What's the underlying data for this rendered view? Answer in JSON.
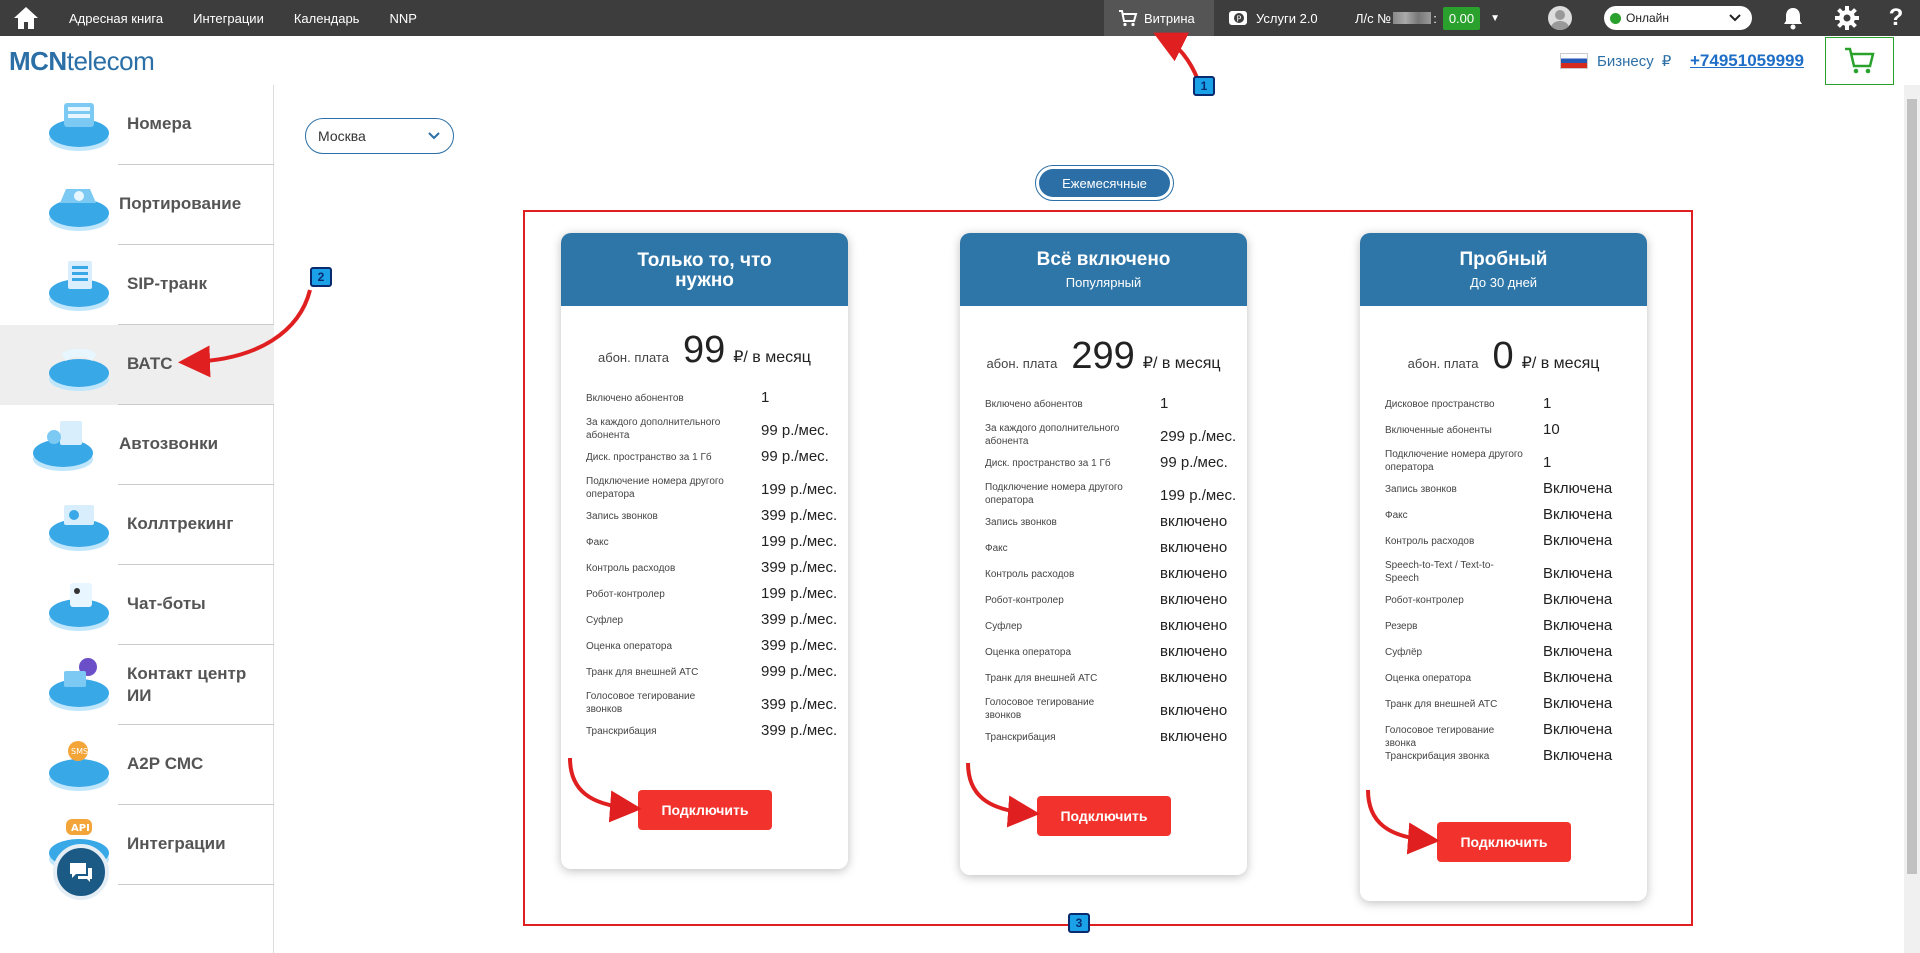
{
  "topbar": {
    "nav": [
      "Адресная книга",
      "Интеграции",
      "Календарь",
      "NNP"
    ],
    "vitrina": "Витрина",
    "uslugi": "Услуги 2.0",
    "account_prefix": "Л/с №",
    "account_suffix": ":",
    "balance": "0.00",
    "status": "Онлайн"
  },
  "header": {
    "logo_bold": "MCN",
    "logo_rest": "telecom",
    "business": "Бизнесу",
    "currency": "₽",
    "phone": "+74951059999"
  },
  "sidebar": {
    "items": [
      {
        "label": "Номера"
      },
      {
        "label": "Портирование"
      },
      {
        "label": "SIP-транк"
      },
      {
        "label": "ВАТС"
      },
      {
        "label": "Автозвонки"
      },
      {
        "label": "Коллтрекинг"
      },
      {
        "label": "Чат-боты"
      },
      {
        "label": "Контакт центр ИИ"
      },
      {
        "label": "А2Р СМС"
      },
      {
        "label": "Интеграции"
      }
    ],
    "active_index": 3
  },
  "main": {
    "city": "Москва",
    "period": "Ежемесячные"
  },
  "plans": [
    {
      "title": "Только то, что нужно",
      "subtitle": "",
      "price_prefix": "абон. плата",
      "price": "99",
      "price_suffix": "₽/ в месяц",
      "button": "Подключить",
      "features": [
        {
          "name": "Включено абонентов",
          "value": "1"
        },
        {
          "name": "За каждого дополнительного абонента",
          "value": "99 р./мес."
        },
        {
          "name": "Диск. пространство за 1 Гб",
          "value": "99 р./мес."
        },
        {
          "name": "Подключение номера другого оператора",
          "value": "199 р./мес."
        },
        {
          "name": "Запись звонков",
          "value": "399 р./мес."
        },
        {
          "name": "Факс",
          "value": "199 р./мес."
        },
        {
          "name": "Контроль расходов",
          "value": "399 р./мес."
        },
        {
          "name": "Робот-контролер",
          "value": "199 р./мес."
        },
        {
          "name": "Суфлер",
          "value": "399 р./мес."
        },
        {
          "name": "Оценка оператора",
          "value": "399 р./мес."
        },
        {
          "name": "Транк для внешней АТС",
          "value": "999 р./мес."
        },
        {
          "name": "Голосовое тегирование звонков",
          "value": "399 р./мес."
        },
        {
          "name": "Транскрибация",
          "value": "399 р./мес."
        }
      ]
    },
    {
      "title": "Всё включено",
      "subtitle": "Популярный",
      "price_prefix": "абон. плата",
      "price": "299",
      "price_suffix": "₽/ в месяц",
      "button": "Подключить",
      "features": [
        {
          "name": "Включено абонентов",
          "value": "1"
        },
        {
          "name": "За каждого дополнительного абонента",
          "value": "299 р./мес."
        },
        {
          "name": "Диск. пространство за 1 Гб",
          "value": "99 р./мес."
        },
        {
          "name": "Подключение номера другого оператора",
          "value": "199 р./мес."
        },
        {
          "name": "Запись звонков",
          "value": "включено"
        },
        {
          "name": "Факс",
          "value": "включено"
        },
        {
          "name": "Контроль расходов",
          "value": "включено"
        },
        {
          "name": "Робот-контролер",
          "value": "включено"
        },
        {
          "name": "Суфлер",
          "value": "включено"
        },
        {
          "name": "Оценка оператора",
          "value": "включено"
        },
        {
          "name": "Транк для внешней АТС",
          "value": "включено"
        },
        {
          "name": "Голосовое тегирование звонков",
          "value": "включено"
        },
        {
          "name": "Транскрибация",
          "value": "включено"
        }
      ]
    },
    {
      "title": "Пробный",
      "subtitle": "До 30 дней",
      "price_prefix": "абон. плата",
      "price": "0",
      "price_suffix": "₽/ в месяц",
      "button": "Подключить",
      "features": [
        {
          "name": "Дисковое пространство",
          "value": "1"
        },
        {
          "name": "Включенные абоненты",
          "value": "10"
        },
        {
          "name": "Подключение номера другого оператора",
          "value": "1"
        },
        {
          "name": "Запись звонков",
          "value": "Включена"
        },
        {
          "name": "Факс",
          "value": "Включена"
        },
        {
          "name": "Контроль расходов",
          "value": "Включена"
        },
        {
          "name": "Speech-to-Text / Text-to-Speech",
          "value": "Включена"
        },
        {
          "name": "Робот-контролер",
          "value": "Включена"
        },
        {
          "name": "Резерв",
          "value": "Включена"
        },
        {
          "name": "Суфлёр",
          "value": "Включена"
        },
        {
          "name": "Оценка оператора",
          "value": "Включена"
        },
        {
          "name": "Транк для внешней АТС",
          "value": "Включена"
        },
        {
          "name": "Голосовое тегирование звонка",
          "value": "Включена"
        },
        {
          "name": "Транскрибация звонка",
          "value": "Включена"
        }
      ]
    }
  ],
  "annotations": [
    "1",
    "2",
    "3"
  ]
}
